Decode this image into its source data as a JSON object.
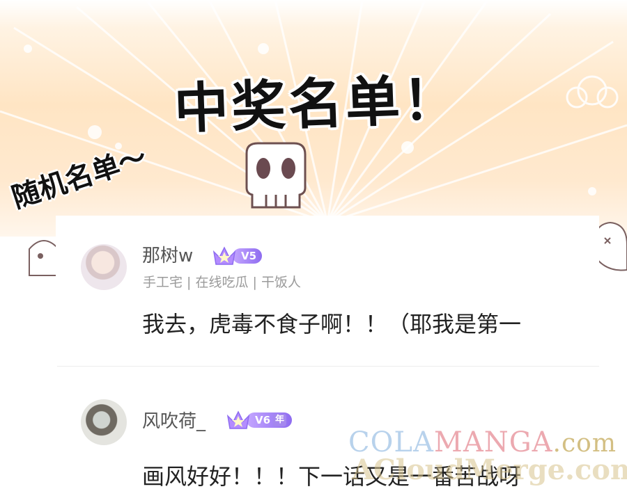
{
  "banner": {
    "title": "中奖名单！",
    "subtitle": "随机名单～"
  },
  "comments": [
    {
      "username": "那树w",
      "level": "V5",
      "tags": "手工宅 | 在线吃瓜 | 干饭人",
      "text": "我去，虎毒不食子啊！！（耶我是第一"
    },
    {
      "username": "风吹荷_",
      "level": "V6",
      "year_badge": "年",
      "text": "画风好好！！！下一话又是一番苦战呀"
    }
  ],
  "watermark": {
    "part1": "COLA",
    "part2": "MANGA",
    "part3": ".com",
    "line2": "ACloudMerge.com"
  },
  "icons": {
    "crown": "crown-icon",
    "skull": "skull-icon"
  },
  "colors": {
    "background_top": "#ffe5c4",
    "level_badge": "#8e6cf0",
    "username": "#555555",
    "comment_text": "#222222",
    "tags": "#9a9a9a"
  }
}
